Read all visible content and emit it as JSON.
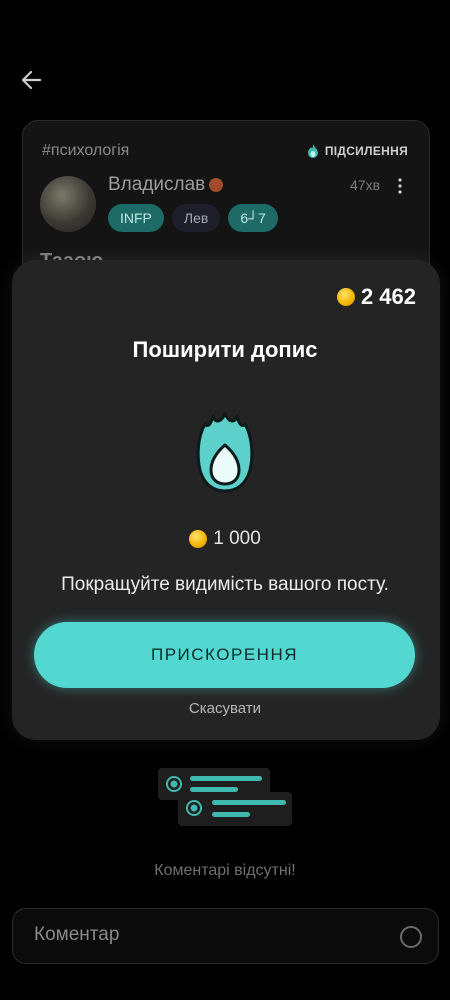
{
  "post": {
    "hashtag": "#психологія",
    "boost_tag": "ПІДСИЛЕННЯ",
    "author": "Владислав",
    "time": "47хв",
    "tags": [
      "INFP",
      "Лев",
      "6┘7"
    ],
    "title_partial": "Тааою"
  },
  "modal": {
    "balance": "2 462",
    "title": "Поширити допис",
    "price": "1 000",
    "description": "Покращуйте видимість вашого посту.",
    "boost_button": "ПРИСКОРЕННЯ",
    "cancel": "Скасувати"
  },
  "comments": {
    "empty_text": "Коментарі відсутні!",
    "placeholder": "Коментар"
  },
  "colors": {
    "accent": "#52d8d0",
    "coin": "#f1b400",
    "background": "#000000",
    "modal": "#242424"
  }
}
